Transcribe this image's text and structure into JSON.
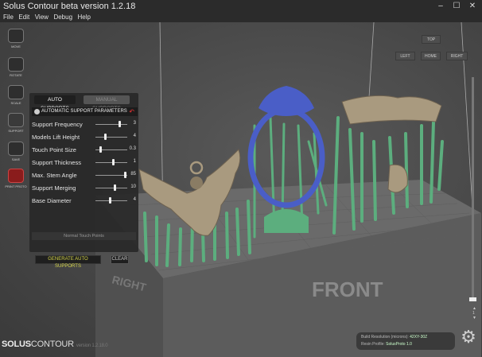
{
  "window": {
    "title": "Solus Contour beta version 1.2.18",
    "min": "–",
    "max": "☐",
    "close": "✕"
  },
  "menu": [
    "File",
    "Edit",
    "View",
    "Debug",
    "Help"
  ],
  "toolbar": [
    {
      "label": "MOVE",
      "icon": "move-icon"
    },
    {
      "label": "ROTATE",
      "icon": "rotate-icon"
    },
    {
      "label": "SCALE",
      "icon": "scale-icon"
    },
    {
      "label": "SUPPORT",
      "icon": "support-icon"
    },
    {
      "label": "SAVE",
      "icon": "folder-icon"
    },
    {
      "label": "PRINT PROTO",
      "icon": "print-icon"
    }
  ],
  "supports": {
    "tab_auto": "AUTO SUPPORTS",
    "tab_manual": "MANUAL SUPPORTS",
    "header": "AUTOMATIC SUPPORT PARAMETERS",
    "params": [
      {
        "name": "Support Frequency",
        "value": "3",
        "level": 0.75
      },
      {
        "name": "Models Lift Height",
        "value": "4",
        "level": 0.3
      },
      {
        "name": "Touch Point Size",
        "value": "0.3",
        "level": 0.12
      },
      {
        "name": "Support Thickness",
        "value": "1",
        "level": 0.55
      },
      {
        "name": "Max. Stem Angle",
        "value": "85",
        "level": 0.95
      },
      {
        "name": "Support Merging",
        "value": "10",
        "level": 0.6
      },
      {
        "name": "Base Diameter",
        "value": "4",
        "level": 0.45
      }
    ],
    "normal_touch": "Normal Touch Points",
    "generate": "GENERATE AUTO SUPPORTS",
    "clear": "CLEAR"
  },
  "view_buttons": {
    "top": "TOP",
    "left": "LEFT",
    "home": "HOME",
    "right": "RIGHT"
  },
  "scene": {
    "front_label": "FRONT",
    "right_label": "RIGHT"
  },
  "slider": {
    "up": "▲",
    "num": "1",
    "down": "▼"
  },
  "info": {
    "resolution_label": "Build Resolution (microns):",
    "resolution_value": "42XY-30Z",
    "profile_label": "Resin Profile:",
    "profile_value": "SolusProto 1.0"
  },
  "brand": {
    "bold": "SOLUS",
    "normal": "CONTOUR",
    "version": "version 1.2.18.0"
  },
  "colors": {
    "support": "#5cae7e",
    "ring": "#4a5ec7",
    "gold": "#a99a7f",
    "platform": "#5a5a5a"
  }
}
